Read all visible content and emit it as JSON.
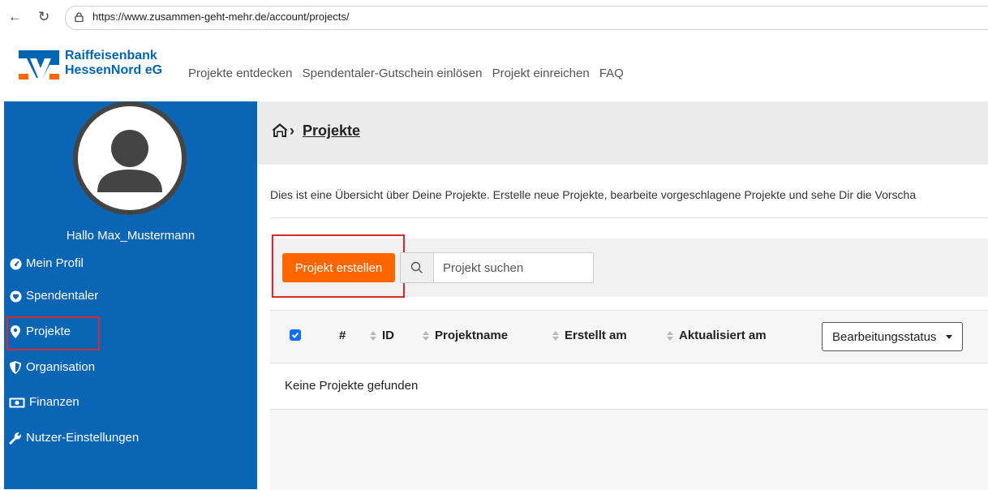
{
  "browser": {
    "url": "https://www.zusammen-geht-mehr.de/account/projects/"
  },
  "header": {
    "logo_line1": "Raiffeisenbank",
    "logo_line2": "HessenNord eG",
    "nav": [
      "Projekte entdecken",
      "Spendentaler-Gutschein einlösen",
      "Projekt einreichen",
      "FAQ"
    ]
  },
  "sidebar": {
    "greeting": "Hallo Max_Mustermann",
    "items": [
      {
        "label": "Mein Profil",
        "icon": "dashboard-icon"
      },
      {
        "label": "Spendentaler",
        "icon": "heart-icon"
      },
      {
        "label": "Projekte",
        "icon": "map-marker-icon"
      },
      {
        "label": "Organisation",
        "icon": "shield-icon"
      },
      {
        "label": "Finanzen",
        "icon": "money-icon"
      },
      {
        "label": "Nutzer-Einstellungen",
        "icon": "wrench-icon"
      }
    ],
    "active": "Projekte"
  },
  "main": {
    "breadcrumb_title": "Projekte",
    "intro": "Dies ist eine Übersicht über Deine Projekte. Erstelle neue Projekte, bearbeite vorgeschlagene Projekte und sehe Dir die Vorscha",
    "create_button": "Projekt erstellen",
    "search_placeholder": "Projekt suchen",
    "table": {
      "columns": [
        "#",
        "ID",
        "Projektname",
        "Erstellt am",
        "Aktualisiert am"
      ],
      "status_dropdown": "Bearbeitungsstatus",
      "empty_text": "Keine Projekte gefunden"
    }
  },
  "colors": {
    "sidebar_blue": "#0a66b4",
    "brand_blue": "#0066b3",
    "create_orange": "#ff6600",
    "highlight_red": "#d9282f"
  }
}
